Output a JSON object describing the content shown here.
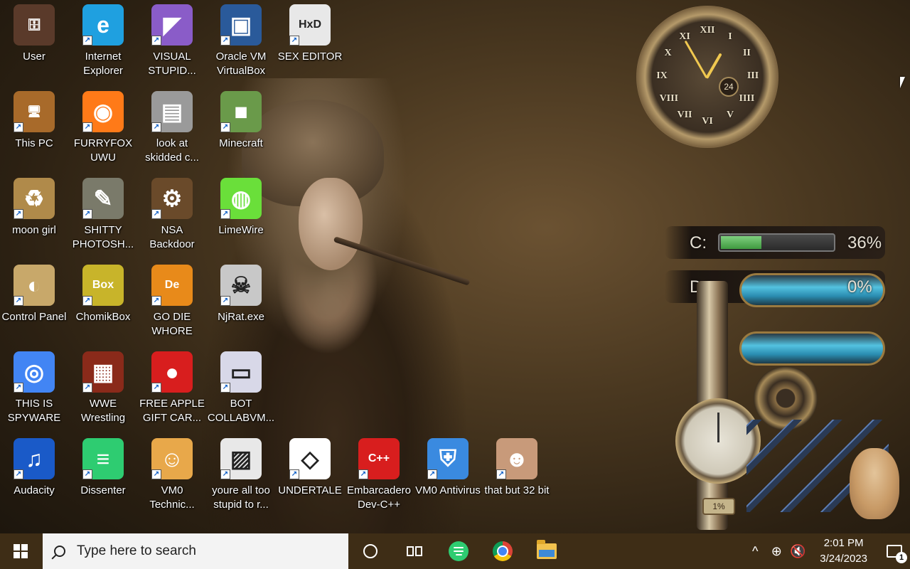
{
  "desktop": {
    "icons": [
      {
        "label": "User",
        "icon": "user-folder-icon",
        "color": "#5a3a2a"
      },
      {
        "label": "Internet Explorer",
        "icon": "edge-icon",
        "color": "#1fa0e0"
      },
      {
        "label": "VISUAL STUPID...",
        "icon": "visual-studio-icon",
        "color": "#8a5cc8"
      },
      {
        "label": "Oracle VM VirtualBox",
        "icon": "virtualbox-icon",
        "color": "#2a5a9a"
      },
      {
        "label": "SEX EDITOR",
        "icon": "hxd-icon",
        "color": "#e8e8e8"
      },
      {
        "label": "This PC",
        "icon": "computer-icon",
        "color": "#a86a2a"
      },
      {
        "label": "FURRYFOX UWU",
        "icon": "firefox-icon",
        "color": "#ff7a18"
      },
      {
        "label": "look at skidded c...",
        "icon": "stack-icon",
        "color": "#9a9a9a"
      },
      {
        "label": "Minecraft",
        "icon": "minecraft-icon",
        "color": "#6a9a4a"
      },
      {
        "label": "moon girl",
        "icon": "recycle-bin-icon",
        "color": "#b08a4a"
      },
      {
        "label": "SHITTY PHOTOSH...",
        "icon": "gimp-icon",
        "color": "#7a7a6a"
      },
      {
        "label": "NSA Backdoor",
        "icon": "gears-icon",
        "color": "#6a4a2a"
      },
      {
        "label": "LimeWire",
        "icon": "limewire-icon",
        "color": "#6adf3a"
      },
      {
        "label": "Control Panel",
        "icon": "control-panel-icon",
        "color": "#c8a86a"
      },
      {
        "label": "ChomikBox",
        "icon": "hamster-icon",
        "color": "#c8b42a"
      },
      {
        "label": "GO DIE WHORE",
        "icon": "de-icon",
        "color": "#e88a1a"
      },
      {
        "label": "NjRat.exe",
        "icon": "skull-icon",
        "color": "#c8c8c8"
      },
      {
        "label": "THIS IS SPYWARE",
        "icon": "chrome-icon",
        "color": "#4285f4"
      },
      {
        "label": "WWE Wrestling",
        "icon": "tv-icon",
        "color": "#8a2a1a"
      },
      {
        "label": "FREE APPLE GIFT CAR...",
        "icon": "apple-icon",
        "color": "#d81e1e"
      },
      {
        "label": "BOT COLLABVM...",
        "icon": "monitor-icon",
        "color": "#d8d8e8"
      },
      {
        "label": "Audacity",
        "icon": "audacity-icon",
        "color": "#1a5ac8"
      },
      {
        "label": "Dissenter",
        "icon": "dissenter-icon",
        "color": "#2ecc71"
      },
      {
        "label": "VM0 Technic...",
        "icon": "technician-icon",
        "color": "#e8a84a"
      },
      {
        "label": "youre all too stupid to r...",
        "icon": "photo-icon",
        "color": "#e8e8e8"
      },
      {
        "label": "UNDERTALE",
        "icon": "unity-icon",
        "color": "#ffffff"
      },
      {
        "label": "Embarcadero Dev-C++",
        "icon": "devcpp-icon",
        "color": "#d81e1e"
      },
      {
        "label": "VM0 Antivirus",
        "icon": "shield-icon",
        "color": "#3a8ae0"
      },
      {
        "label": "that but 32 bit",
        "icon": "portrait-icon",
        "color": "#c89a7a"
      }
    ]
  },
  "gadgets": {
    "clock": {
      "numerals": [
        "XII",
        "I",
        "II",
        "III",
        "IIII",
        "V",
        "VI",
        "VII",
        "VIII",
        "IX",
        "X",
        "XI"
      ],
      "date": "24"
    },
    "drives": {
      "c_label": "C:",
      "c_percent": "36%",
      "c_fraction": 0.36,
      "d_label": "D:",
      "d_percent": "0%",
      "small_gauge": "1%"
    }
  },
  "taskbar": {
    "search_placeholder": "Type here to search",
    "time": "2:01 PM",
    "date": "3/24/2023",
    "notification_count": "1",
    "tray": {
      "chevron": "^",
      "network": "⊕",
      "volume": "🔇"
    }
  }
}
